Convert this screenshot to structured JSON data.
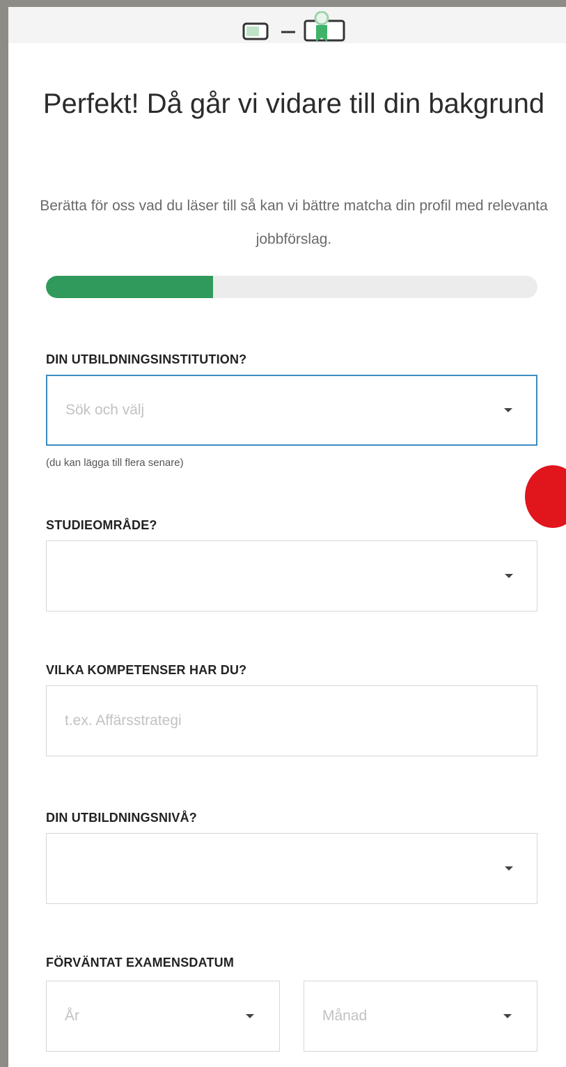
{
  "header": {
    "title": "Perfekt! Då går vi vidare till din bakgrund",
    "subtitle": "Berätta för oss vad du läser till så kan vi bättre matcha din profil med relevanta jobbförslag."
  },
  "progress": {
    "value": 0.34,
    "color": "#2f9a5b"
  },
  "form": {
    "institution": {
      "label": "DIN UTBILDNINGSINSTITUTION?",
      "placeholder": "Sök och välj",
      "hint": "(du kan lägga till flera senare)"
    },
    "study_area": {
      "label": "STUDIEOMRÅDE?",
      "value": ""
    },
    "skills": {
      "label": "VILKA KOMPETENSER HAR DU?",
      "placeholder": "t.ex. Affärsstrategi"
    },
    "education_level": {
      "label": "DIN UTBILDNINGSNIVÅ?",
      "value": ""
    },
    "graduation": {
      "label": "FÖRVÄNTAT EXAMENSDATUM",
      "year_placeholder": "År",
      "month_placeholder": "Månad"
    }
  },
  "icons": {
    "header": "diploma-illustration-icon",
    "dropdown": "caret-down-icon"
  },
  "colors": {
    "accent_green": "#2f9a5b",
    "focus_blue": "#3a8bc0",
    "overlay_red": "#e1151c"
  }
}
